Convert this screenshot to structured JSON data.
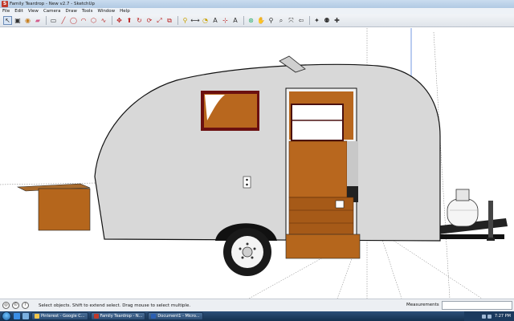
{
  "window": {
    "title": "Family Teardrop - New v2.7 - SketchUp",
    "app_icon": "sketchup-icon"
  },
  "menu": [
    "File",
    "Edit",
    "View",
    "Camera",
    "Draw",
    "Tools",
    "Window",
    "Help"
  ],
  "toolbar": {
    "icons": [
      "select-icon",
      "component-icon",
      "paint-bucket-icon",
      "eraser-icon",
      "rectangle-icon",
      "line-icon",
      "circle-icon",
      "arc-icon",
      "polygon-icon",
      "freehand-icon",
      "move-icon",
      "push-pull-icon",
      "rotate-icon",
      "follow-me-icon",
      "scale-icon",
      "offset-icon",
      "tape-measure-icon",
      "dimension-icon",
      "protractor-icon",
      "text-icon",
      "axes-icon",
      "3d-text-icon",
      "orbit-icon",
      "pan-icon",
      "zoom-icon",
      "zoom-window-icon",
      "zoom-extents-icon",
      "previous-icon",
      "position-camera-icon",
      "walk-icon",
      "look-around-icon"
    ]
  },
  "status": {
    "message": "Select objects. Shift to extend select. Drag mouse to select multiple.",
    "measurements_label": "Measurements",
    "measurements_value": ""
  },
  "taskbar": {
    "tasks": [
      {
        "label": "Pinterest - Google C...",
        "color": "#f3c74b"
      },
      {
        "label": "Family Teardrop - N...",
        "color": "#c0392b"
      },
      {
        "label": "Document1 - Micro...",
        "color": "#2b5fb3"
      }
    ],
    "clock": "7:27 PM"
  },
  "colors": {
    "shell": "#dcdcdc",
    "wood": "#b8671e",
    "wood_dark": "#8a4712",
    "trim": "#6b1010",
    "tire": "#1a1a1a",
    "propane": "#f4f4f4"
  }
}
